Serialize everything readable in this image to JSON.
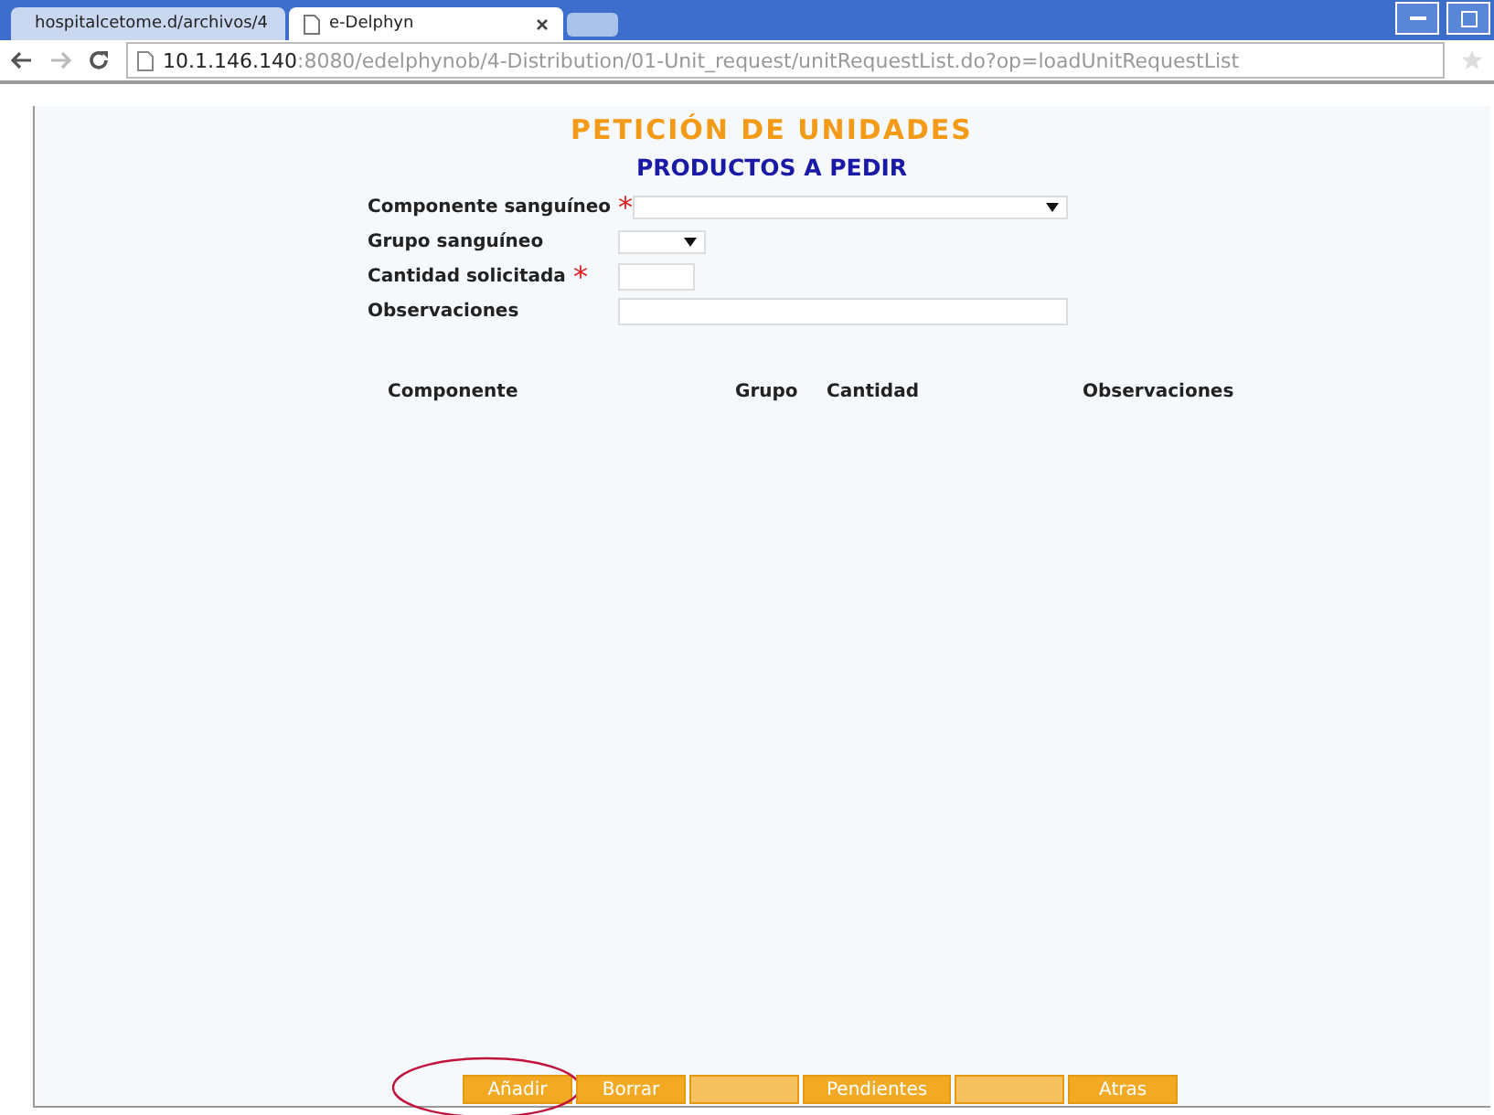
{
  "browser": {
    "tabs": [
      {
        "title": "hospitalcetome.d/archivos/4",
        "selected": false
      },
      {
        "title": "e-Delphyn",
        "selected": true
      }
    ],
    "address": {
      "host": "10.1.146.140",
      "path": ":8080/edelphynob/4-Distribution/01-Unit_request/unitRequestList.do?op=loadUnitRequestList"
    }
  },
  "page": {
    "title": "PETICIÓN DE UNIDADES",
    "subtitle": "PRODUCTOS A PEDIR",
    "fields": [
      {
        "label": "Componente sanguíneo",
        "required_mark": "*",
        "kind": "select"
      },
      {
        "label": "Grupo sanguíneo",
        "kind": "select"
      },
      {
        "label": "Cantidad solicitada",
        "required_mark": "*",
        "kind": "text"
      },
      {
        "label": "Observaciones",
        "kind": "text"
      }
    ],
    "table": {
      "columns": [
        "Componente",
        "Grupo",
        "Cantidad",
        "Observaciones"
      ]
    },
    "buttons": [
      {
        "label": "Añadir",
        "disabled": false,
        "circled": true
      },
      {
        "label": "Borrar",
        "disabled": false,
        "circled": false
      },
      {
        "disabled": true,
        "circled": false
      },
      {
        "label": "Pendientes",
        "disabled": false,
        "circled": false
      },
      {
        "disabled": true,
        "circled": false
      },
      {
        "label": "Atras",
        "disabled": false,
        "circled": false
      }
    ]
  }
}
